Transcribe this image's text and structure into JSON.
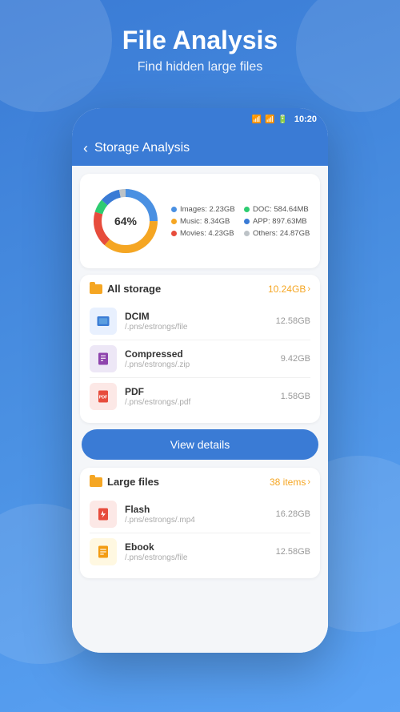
{
  "background": {
    "gradient_start": "#3a7bd5",
    "gradient_end": "#5ba3f5"
  },
  "header": {
    "title": "File Analysis",
    "subtitle": "Find hidden large files"
  },
  "status_bar": {
    "time": "10:20"
  },
  "app_header": {
    "title": "Storage Analysis",
    "back_label": "<"
  },
  "donut_chart": {
    "center_label": "64%",
    "segments": [
      {
        "label": "Images",
        "value": "2.23GB",
        "color": "#4a90e2",
        "percent": 22
      },
      {
        "label": "Music",
        "value": "8.34GB",
        "color": "#f5a623",
        "percent": 32
      },
      {
        "label": "Movies",
        "value": "4.23GB",
        "color": "#e74c3c",
        "percent": 16
      },
      {
        "label": "DOC",
        "value": "584.64MB",
        "color": "#2ecc71",
        "percent": 6
      },
      {
        "label": "APP",
        "value": "897.63MB",
        "color": "#3a7bd5",
        "percent": 9
      },
      {
        "label": "Others",
        "value": "24.87GB",
        "color": "#bdc3c7",
        "percent": 15
      }
    ]
  },
  "all_storage": {
    "section_title": "All storage",
    "section_meta": "10.24GB",
    "items": [
      {
        "name": "DCIM",
        "path": "/.pns/estrongs/file",
        "size": "12.58GB",
        "icon_type": "blue"
      },
      {
        "name": "Compressed",
        "path": "/.pns/estrongs/.zip",
        "size": "9.42GB",
        "icon_type": "purple"
      },
      {
        "name": "PDF",
        "path": "/.pns/estrongs/.pdf",
        "size": "1.58GB",
        "icon_type": "red"
      }
    ]
  },
  "view_details_btn": {
    "label": "View details"
  },
  "large_files": {
    "section_title": "Large files",
    "section_meta": "38 items",
    "items": [
      {
        "name": "Flash",
        "path": "/.pns/estrongs/.mp4",
        "size": "16.28GB",
        "icon_type": "flash"
      },
      {
        "name": "Ebook",
        "path": "/.pns/estrongs/file",
        "size": "12.58GB",
        "icon_type": "ebook"
      }
    ]
  }
}
